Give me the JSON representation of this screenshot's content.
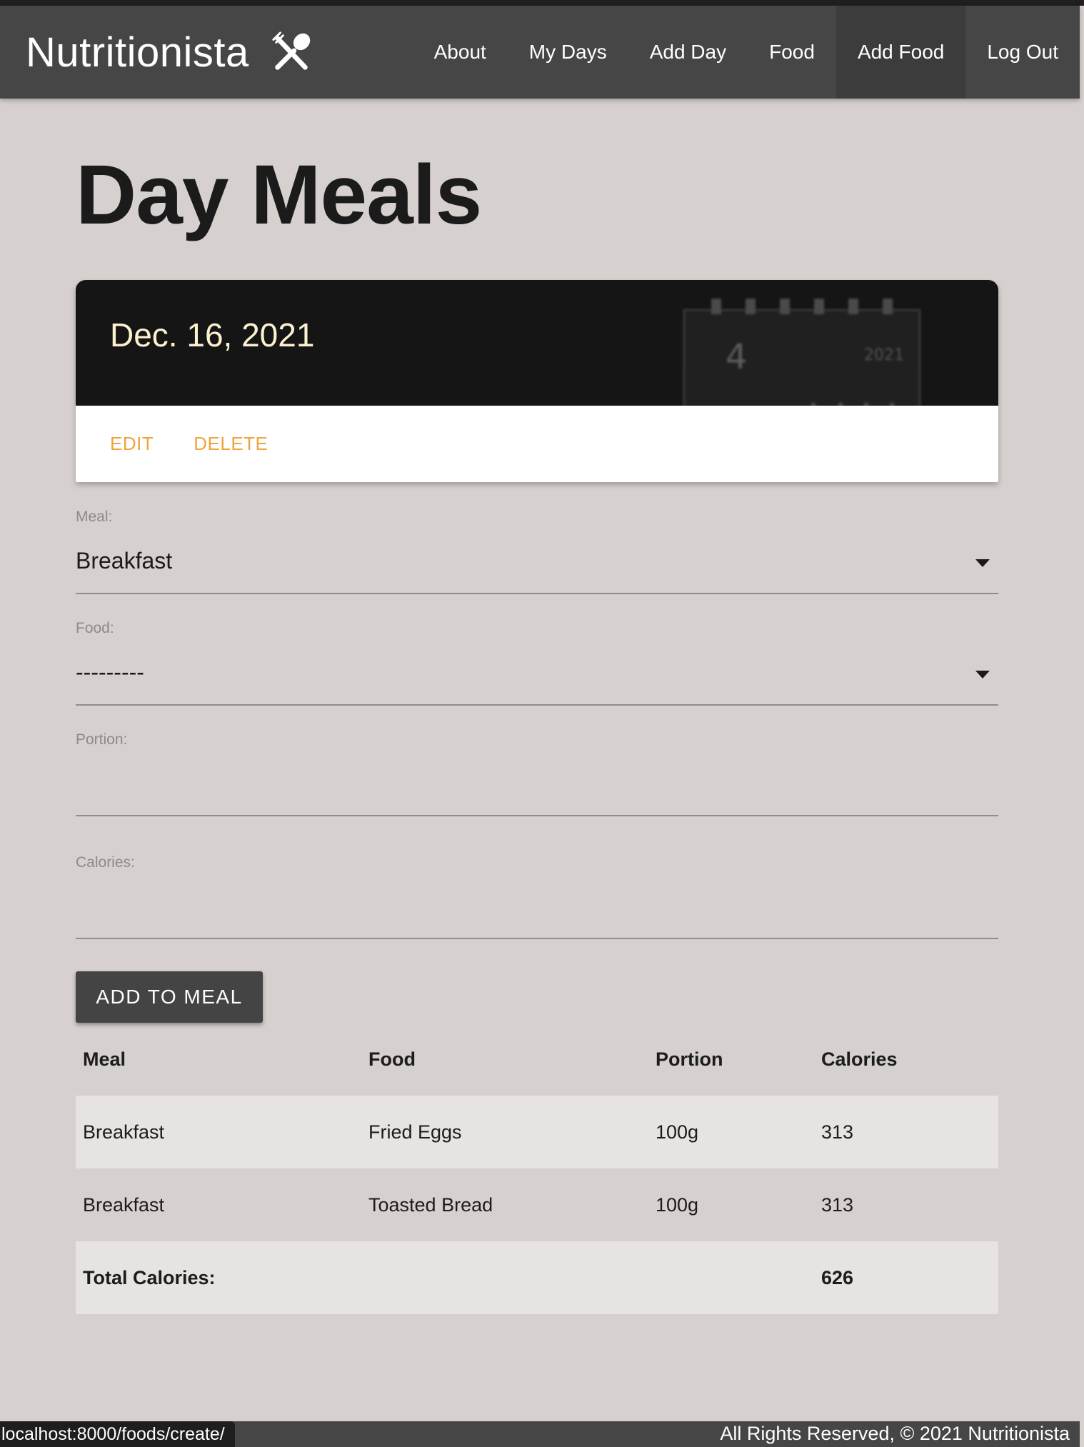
{
  "nav": {
    "brand": "Nutritionista",
    "links": [
      "About",
      "My Days",
      "Add Day",
      "Food",
      "Add Food",
      "Log Out"
    ],
    "active": "Add Food"
  },
  "page": {
    "title": "Day Meals"
  },
  "day_card": {
    "date": "Dec. 16, 2021",
    "edit_label": "EDIT",
    "delete_label": "DELETE",
    "image_text": {
      "day": "4",
      "year": "2021"
    }
  },
  "form": {
    "meal": {
      "label": "Meal:",
      "value": "Breakfast"
    },
    "food": {
      "label": "Food:",
      "value": "---------"
    },
    "portion": {
      "label": "Portion:",
      "value": ""
    },
    "calories": {
      "label": "Calories:",
      "value": ""
    },
    "submit_label": "ADD TO MEAL"
  },
  "table": {
    "headers": [
      "Meal",
      "Food",
      "Portion",
      "Calories"
    ],
    "rows": [
      [
        "Breakfast",
        "Fried Eggs",
        "100g",
        "313"
      ],
      [
        "Breakfast",
        "Toasted Bread",
        "100g",
        "313"
      ]
    ],
    "total_label": "Total Calories:",
    "total_value": "626"
  },
  "footer": {
    "text": "All Rights Reserved, © 2021 Nutritionista"
  },
  "status_bar": {
    "url": "localhost:8000/foods/create/"
  },
  "colors": {
    "background": "#d6d1ce",
    "navbar": "#464646",
    "accent": "#f0a33c",
    "card_header": "#151515",
    "date_text": "#fdf2cf"
  }
}
